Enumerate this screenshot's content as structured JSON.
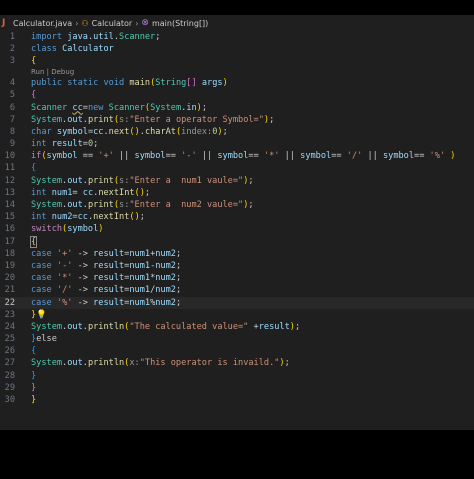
{
  "breadcrumb": {
    "file": "Calculator.java",
    "class_name": "Calculator",
    "method": "main(String[])"
  },
  "code_lens": "Run | Debug",
  "current_line": 22,
  "colors": {
    "background": "#1f1f1f",
    "keyword": "#569cd6",
    "string": "#ce9178",
    "type": "#4ec9b0",
    "method": "#dcdcaa"
  },
  "lines": [
    {
      "n": "1",
      "code": "import java.util.Scanner;"
    },
    {
      "n": "2",
      "code": "class Calculator"
    },
    {
      "n": "3",
      "code": "{"
    },
    {
      "n": "4",
      "code": "public static void main(String[] args)"
    },
    {
      "n": "5",
      "code": "{"
    },
    {
      "n": "6",
      "code": "Scanner cc=new Scanner(System.in);"
    },
    {
      "n": "7",
      "code": "System.out.print(s:\"Enter a operator Symbol=\");"
    },
    {
      "n": "8",
      "code": "char symbol=cc.next().charAt(index:0);"
    },
    {
      "n": "9",
      "code": "int result=0;"
    },
    {
      "n": "10",
      "code": "if(symbol == '+' || symbol== '-' || symbol== '*' || symbol== '/' || symbol== '%' )"
    },
    {
      "n": "11",
      "code": "{"
    },
    {
      "n": "12",
      "code": "System.out.print(s:\"Enter a  num1 vaule=\");"
    },
    {
      "n": "13",
      "code": "int num1= cc.nextInt();"
    },
    {
      "n": "14",
      "code": "System.out.print(s:\"Enter a  num2 vaule=\");"
    },
    {
      "n": "15",
      "code": "int num2=cc.nextInt();"
    },
    {
      "n": "16",
      "code": "switch(symbol)"
    },
    {
      "n": "17",
      "code": "{"
    },
    {
      "n": "18",
      "code": "case '+' -> result=num1+num2;"
    },
    {
      "n": "19",
      "code": "case '-' -> result=num1-num2;"
    },
    {
      "n": "20",
      "code": "case '*' -> result=num1*num2;"
    },
    {
      "n": "21",
      "code": "case '/' -> result=num1/num2;"
    },
    {
      "n": "22",
      "code": "case '%' -> result=num1%num2;"
    },
    {
      "n": "23",
      "code": "}"
    },
    {
      "n": "24",
      "code": "System.out.println(\"The calculated value=\" +result);"
    },
    {
      "n": "25",
      "code": "}else"
    },
    {
      "n": "26",
      "code": "{"
    },
    {
      "n": "27",
      "code": "System.out.println(x:\"This operator is invaild.\");"
    },
    {
      "n": "28",
      "code": "}"
    },
    {
      "n": "29",
      "code": "}"
    },
    {
      "n": "30",
      "code": "}"
    }
  ]
}
